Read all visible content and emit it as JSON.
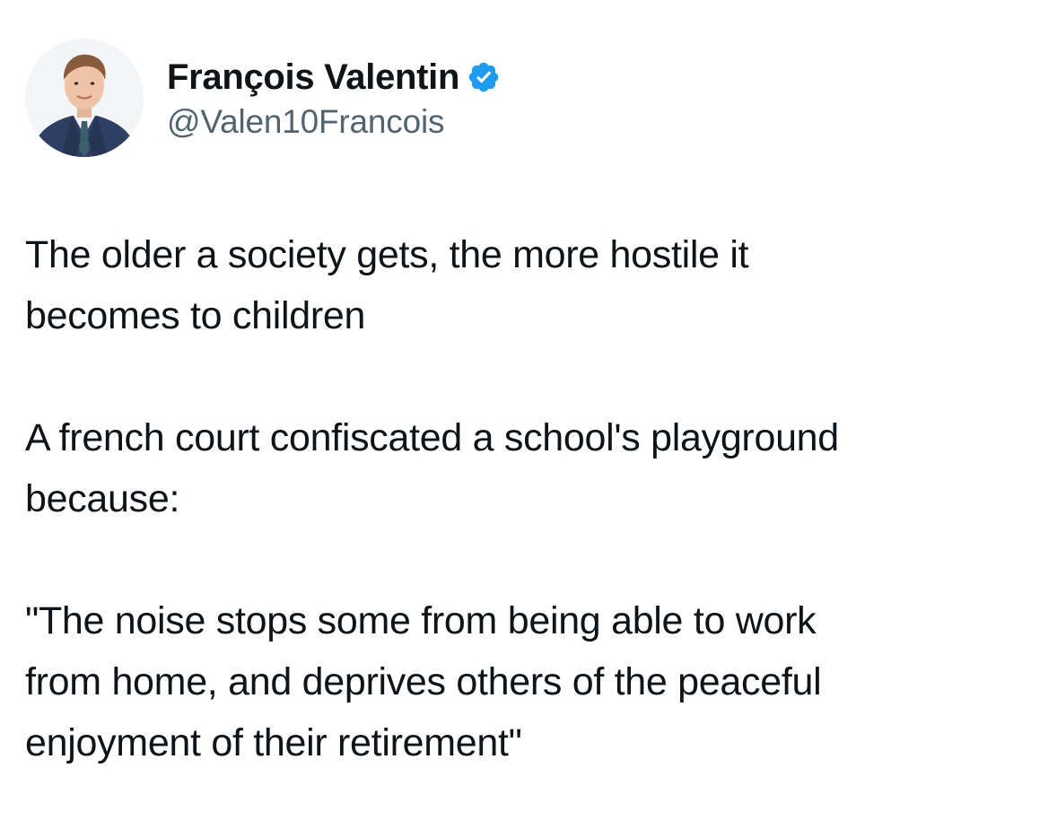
{
  "author": {
    "display_name": "François Valentin",
    "handle": "@Valen10Francois",
    "verified": true,
    "avatar_icon": "profile-photo",
    "badge_icon": "verified-badge-icon",
    "badge_color": "#1d9bf0"
  },
  "tweet": {
    "para1_line1": "The older a society gets, the more hostile it",
    "para1_line2": "becomes to children",
    "para2_line1": "A french court confiscated a school's playground",
    "para2_line2": "because:",
    "para3_line1": "\"The noise stops some from being able to work",
    "para3_line2": "from home, and deprives others of the peaceful",
    "para3_line3": "enjoyment of their retirement\""
  },
  "colors": {
    "text": "#0f1419",
    "secondary_text": "#536471",
    "background": "#ffffff"
  }
}
